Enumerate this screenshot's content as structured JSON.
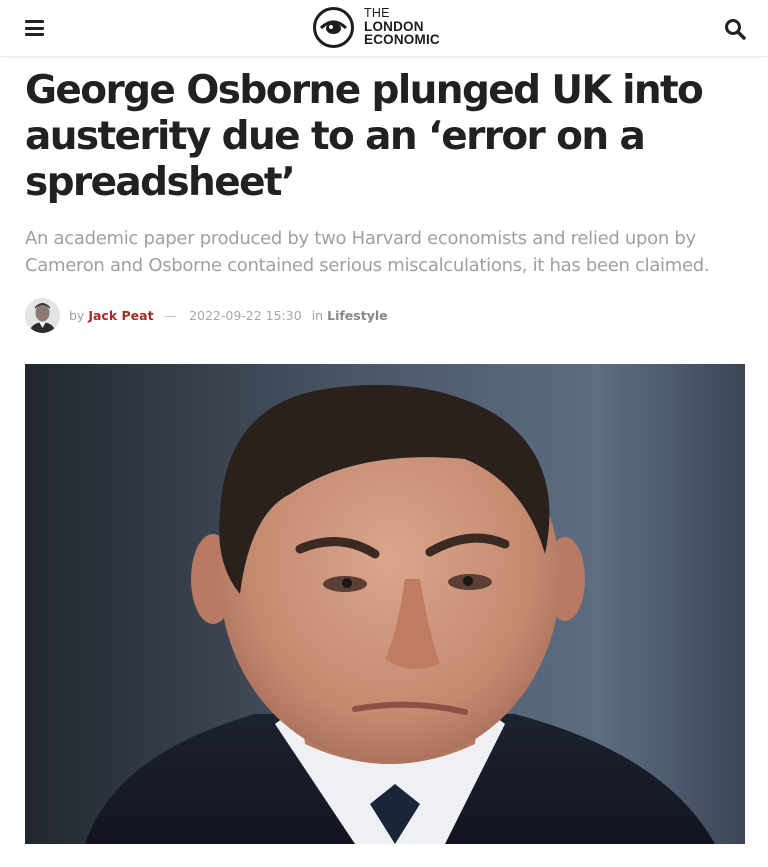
{
  "header": {
    "menu_icon": "hamburger-menu-icon",
    "logo_lines": [
      "THE",
      "LONDON",
      "ECONOMIC"
    ],
    "logo_icon": "eye-icon",
    "search_icon": "search-icon"
  },
  "article": {
    "headline": "George Osborne plunged UK into austerity due to an ‘error on a spreadsheet’",
    "subtitle": "An academic paper produced by two Harvard economists and relied upon by Cameron and Osborne contained serious miscalculations, it has been claimed.",
    "by_label": "by",
    "author": "Jack Peat",
    "separator": "—",
    "date": "2022-09-22 15:30",
    "in_label": "in",
    "category": "Lifestyle"
  },
  "colors": {
    "author_link": "#a52a2a",
    "headline": "#212121",
    "subtitle": "#a0a0a0"
  }
}
